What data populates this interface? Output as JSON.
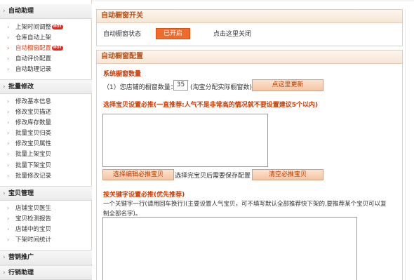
{
  "sidebar": {
    "groups": [
      {
        "title": "自动助理",
        "items": [
          "上架时间调整",
          "仓库自动上架",
          "自动橱窗配置",
          "自动评价配置",
          "自动助理记录"
        ]
      },
      {
        "title": "批量修改",
        "items": [
          "修改基本信息",
          "修改宝贝描述",
          "修改库存数量",
          "批量宝贝归类",
          "修改宝贝属性",
          "批量上架宝贝",
          "批量下架宝贝",
          "批量修改记录"
        ]
      },
      {
        "title": "宝贝管理",
        "items": [
          "店铺宝贝医生",
          "宝贝检测报告",
          "店铺中的宝贝",
          "下架时间统计"
        ]
      },
      {
        "title": "营销推广",
        "items": []
      },
      {
        "title": "行销助理",
        "items": []
      }
    ],
    "hot_badge": "HOT",
    "active_item": "自动橱窗配置"
  },
  "switch_panel": {
    "title": "自动橱窗开关",
    "status_label": "自动橱窗状态",
    "status_button": "已开启",
    "close_link": "点击这里关闭"
  },
  "config_panel": {
    "title": "自动橱窗配置",
    "count_section_title": "系统橱窗数量",
    "count_prefix": "（1）您店铺的橱窗数量：",
    "count_value": "35",
    "count_suffix": "(淘宝分配实际橱窗数)",
    "update_button": "点这里更新",
    "select_title": "选择宝贝设置必推(一直推荐:人气不是非常高的情况就不要设置建议5个以内)",
    "select_button": "选择编辑必推宝贝",
    "select_hint": "选择完宝贝后需要保存配置",
    "clear_button": "清空必推宝贝",
    "keyword_title": "按关键字设置必推(优先推荐)",
    "keyword_desc_line1": "一个关键字一行(请用回车换行)(主要设置人气宝贝，可不填写默认全部推荐快下架的,要推荐某个宝贝可以复",
    "keyword_desc_line2": "制全部名字)。"
  },
  "colors": {
    "accent": "#f06b2a",
    "title_orange": "#b3541e",
    "active_item": "#d4471c",
    "hot_badge": "#e8261a"
  }
}
